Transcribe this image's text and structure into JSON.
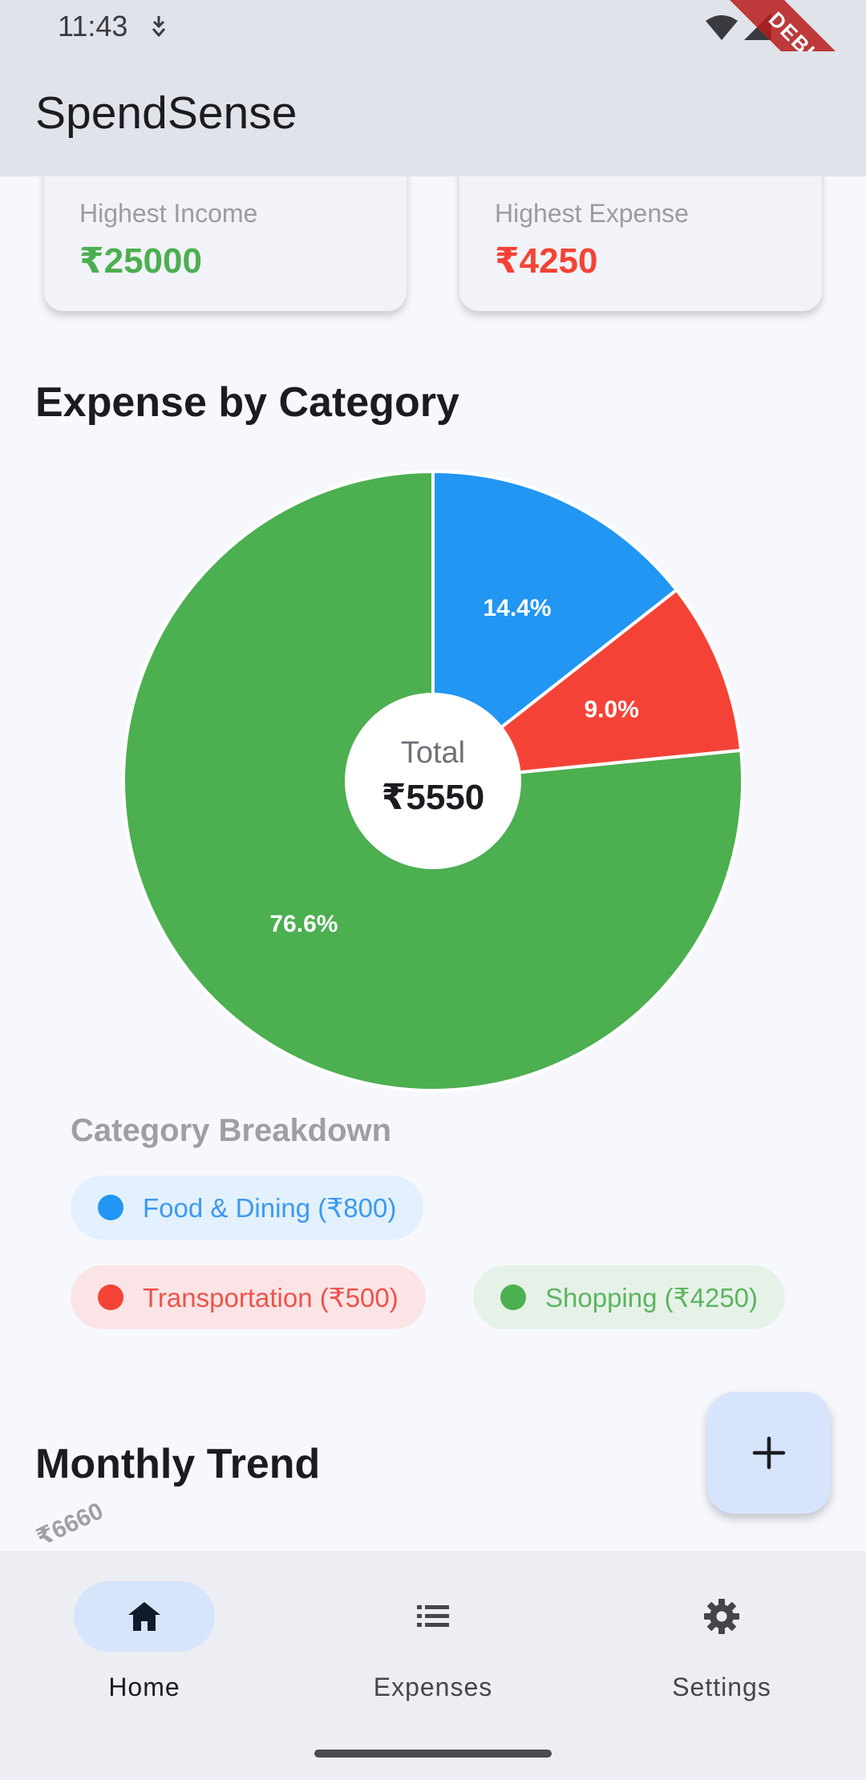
{
  "status_bar": {
    "time": "11:43",
    "debug_label": "DEBUG"
  },
  "app_bar": {
    "title": "SpendSense"
  },
  "stats": {
    "income_label": "Highest Income",
    "income_value": "₹25000",
    "expense_label": "Highest Expense",
    "expense_value": "₹4250"
  },
  "expense_section": {
    "title": "Expense by Category",
    "center_label": "Total",
    "center_value": "₹5550"
  },
  "chart_data": {
    "type": "pie",
    "title": "Expense by Category",
    "slices": [
      {
        "label": "Food & Dining",
        "value": 800,
        "percent_label": "14.4%",
        "color": "#2196f3"
      },
      {
        "label": "Transportation",
        "value": 500,
        "percent_label": "9.0%",
        "color": "#f44336"
      },
      {
        "label": "Shopping",
        "value": 4250,
        "percent_label": "76.6%",
        "color": "#4caf50"
      }
    ],
    "total": 5550
  },
  "breakdown": {
    "title": "Category Breakdown",
    "chips": [
      {
        "label": "Food & Dining (₹800)",
        "color": "#2196f3"
      },
      {
        "label": "Transportation (₹500)",
        "color": "#f44336"
      },
      {
        "label": "Shopping (₹4250)",
        "color": "#4caf50"
      }
    ]
  },
  "trend_section": {
    "title": "Monthly Trend",
    "peek_axis_label": "₹6660"
  },
  "fab": {
    "icon": "add-icon"
  },
  "bottom_nav": {
    "items": [
      {
        "label": "Home",
        "icon": "home-icon",
        "selected": true
      },
      {
        "label": "Expenses",
        "icon": "list-icon",
        "selected": false
      },
      {
        "label": "Settings",
        "icon": "gear-icon",
        "selected": false
      }
    ]
  }
}
